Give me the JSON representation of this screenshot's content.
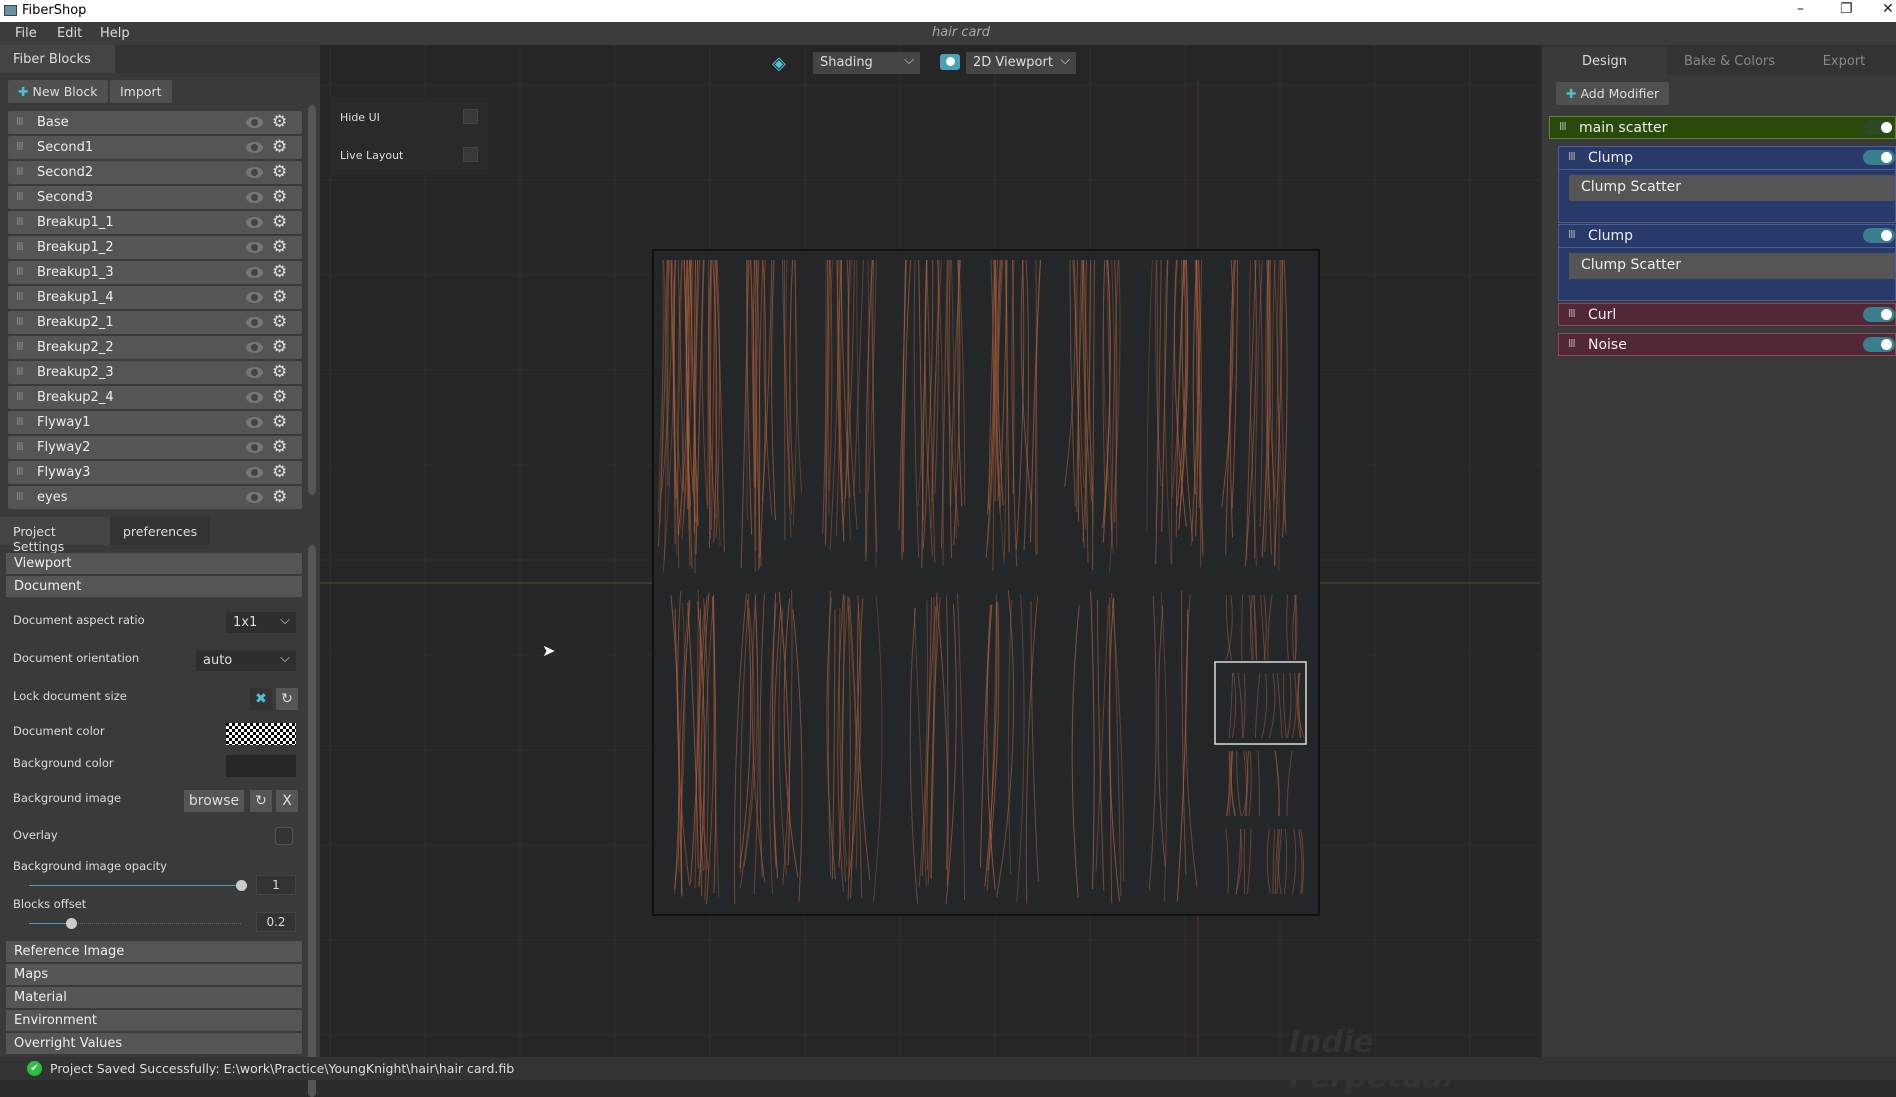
{
  "window": {
    "title": "FiberShop",
    "document_title": "hair card"
  },
  "menu": [
    "File",
    "Edit",
    "Help"
  ],
  "fiber_blocks": {
    "tab": "Fiber Blocks",
    "new_block": "New Block",
    "import": "Import",
    "items": [
      "Base",
      "Second1",
      "Second2",
      "Second3",
      "Breakup1_1",
      "Breakup1_2",
      "Breakup1_3",
      "Breakup1_4",
      "Breakup2_1",
      "Breakup2_2",
      "Breakup2_3",
      "Breakup2_4",
      "Flyway1",
      "Flyway2",
      "Flyway3",
      "eyes"
    ]
  },
  "settings": {
    "tabs": [
      "Project Settings",
      "preferences"
    ],
    "sections_top": [
      "Viewport",
      "Document"
    ],
    "aspect_label": "Document aspect ratio",
    "aspect_value": "1x1",
    "orientation_label": "Document orientation",
    "orientation_value": "auto",
    "lock_label": "Lock document size",
    "doc_color_label": "Document color",
    "bg_color_label": "Background color",
    "bg_color": "#262626",
    "bg_image_label": "Background image",
    "browse": "browse",
    "clear": "X",
    "overlay_label": "Overlay",
    "opacity_label": "Background image opacity",
    "opacity_value": "1",
    "opacity_fraction": 1,
    "offset_label": "Blocks offset",
    "offset_value": "0.2",
    "offset_fraction": 0.2,
    "sections_bottom": [
      "Reference Image",
      "Maps",
      "Material",
      "Environment",
      "Overright Values"
    ]
  },
  "viewport": {
    "shading": "Shading",
    "view": "2D Viewport",
    "hide_ui": "Hide UI",
    "live_layout": "Live Layout",
    "watermark": "Indie Perpetual"
  },
  "right": {
    "tabs": [
      "Design",
      "Bake & Colors",
      "Export"
    ],
    "add_modifier": "Add Modifier",
    "main": "main scatter",
    "clump1": "Clump",
    "clump1_sub": "Clump Scatter",
    "clump2": "Clump",
    "clump2_sub": "Clump Scatter",
    "curl": "Curl",
    "noise": "Noise"
  },
  "status": "Project Saved Successfully: E:\\work\\Practice\\YoungKnight\\hair\\hair card.fib",
  "colors": {
    "accent": "#3a9fb0",
    "main_scatter": "#2a4a0c",
    "clump": "#283a6a",
    "curl": "#522838",
    "hair": "#b0603a"
  }
}
